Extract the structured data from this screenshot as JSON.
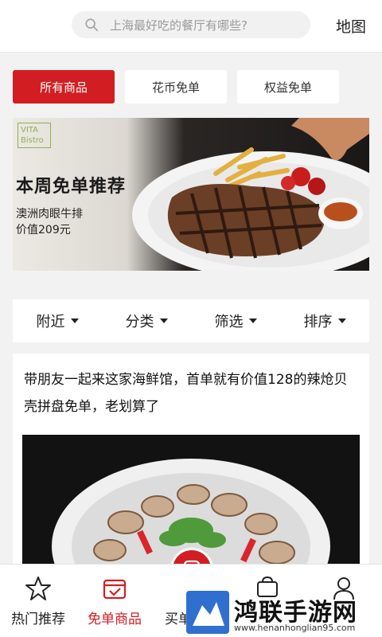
{
  "header": {
    "search_placeholder": "上海最好吃的餐厅有哪些?",
    "map_label": "地图"
  },
  "tabs": [
    {
      "label": "所有商品",
      "active": true
    },
    {
      "label": "花币免单",
      "active": false
    },
    {
      "label": "权益免单",
      "active": false
    }
  ],
  "banner": {
    "brand": "VITA Bistro",
    "title": "本周免单推荐",
    "item_name": "澳洲肉眼牛排",
    "item_price": "价值209元"
  },
  "filters": [
    {
      "label": "附近"
    },
    {
      "label": "分类"
    },
    {
      "label": "筛选"
    },
    {
      "label": "排序"
    }
  ],
  "post": {
    "text": "带朋友一起来这家海鲜馆，首单就有价值128的辣炝贝壳拼盘免单，老划算了"
  },
  "bottom_nav": [
    {
      "label": "热门推荐",
      "icon": "star-icon",
      "active": false
    },
    {
      "label": "免单商品",
      "icon": "free-order-icon",
      "active": true
    },
    {
      "label": "买单",
      "icon": "pay-icon",
      "active": false
    },
    {
      "label": "",
      "icon": "cart-icon",
      "active": false
    },
    {
      "label": "",
      "icon": "profile-icon",
      "active": false
    }
  ],
  "watermark": {
    "title": "鸿联手游网",
    "url": "www.henanhonglian95.com"
  },
  "colors": {
    "accent": "#d21e22",
    "background": "#f2f2f2"
  }
}
